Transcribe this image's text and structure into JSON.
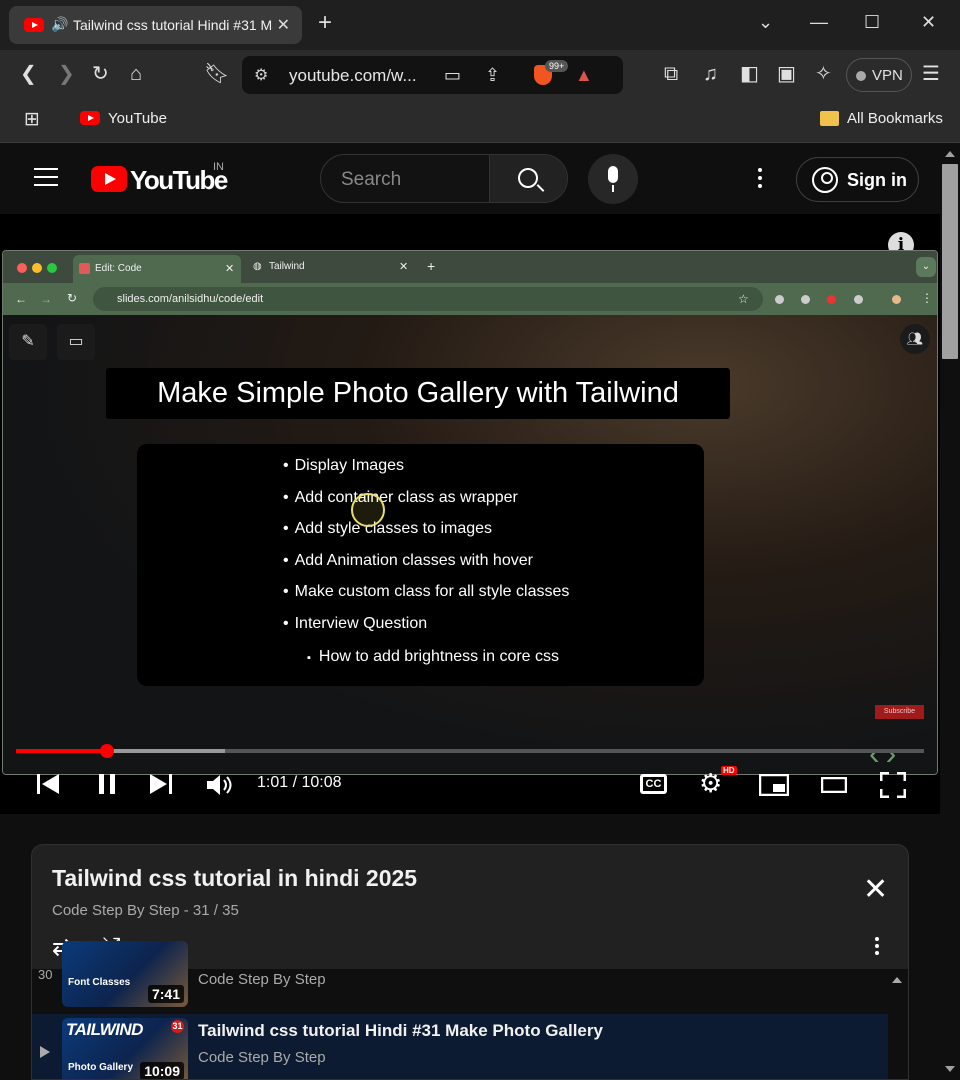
{
  "browser": {
    "tab_title": "Tailwind css tutorial Hindi #31 Make Photo Gallery",
    "url": "youtube.com/w...",
    "badge_count": "99+",
    "vpn_label": "VPN",
    "bookmarks": {
      "youtube": "YouTube",
      "all": "All Bookmarks"
    },
    "window_controls": {
      "list": "⌄",
      "minimize": "—",
      "maximize": "☐",
      "close": "✕"
    }
  },
  "yt": {
    "logo_text": "YouTube",
    "region": "IN",
    "search_placeholder": "Search",
    "sign_in": "Sign in"
  },
  "video": {
    "info": "i",
    "embedded": {
      "tab1": "Edit: Code",
      "tab2": "Tailwind",
      "url": "slides.com/anilsidhu/code/edit",
      "subscribe": "Subscribe"
    },
    "slide": {
      "title": "Make Simple Photo Gallery with Tailwind",
      "bullets": [
        "Display Images",
        "Add container class as wrapper",
        "Add style classes to images",
        "Add Animation classes with hover",
        "Make custom class for all style classes",
        "Interview Question"
      ],
      "sub_bullet": "How to add brightness in core css"
    },
    "player": {
      "time": "1:01 / 10:08",
      "progress": 0.1,
      "buffered": 0.23,
      "cc": "CC",
      "hd": "HD"
    }
  },
  "playlist": {
    "title": "Tailwind css tutorial in hindi 2025",
    "subtitle": "Code Step By Step - 31 / 35",
    "items": [
      {
        "index": "30",
        "title": "",
        "channel": "Code Step By Step",
        "duration": "7:41",
        "thumb_caption": "Font Classes",
        "thumb_num": ""
      },
      {
        "index": "▶",
        "title": "Tailwind css tutorial Hindi #31 Make Photo Gallery",
        "channel": "Code Step By Step",
        "duration": "10:09",
        "thumb_caption": "Photo Gallery",
        "thumb_num": "31"
      }
    ],
    "thumb_brand": "TAILWIND"
  },
  "colors": {
    "accent": "#ff0000",
    "background": "#0f0f0f",
    "panel": "#212121",
    "active_row": "#0c1b32"
  }
}
